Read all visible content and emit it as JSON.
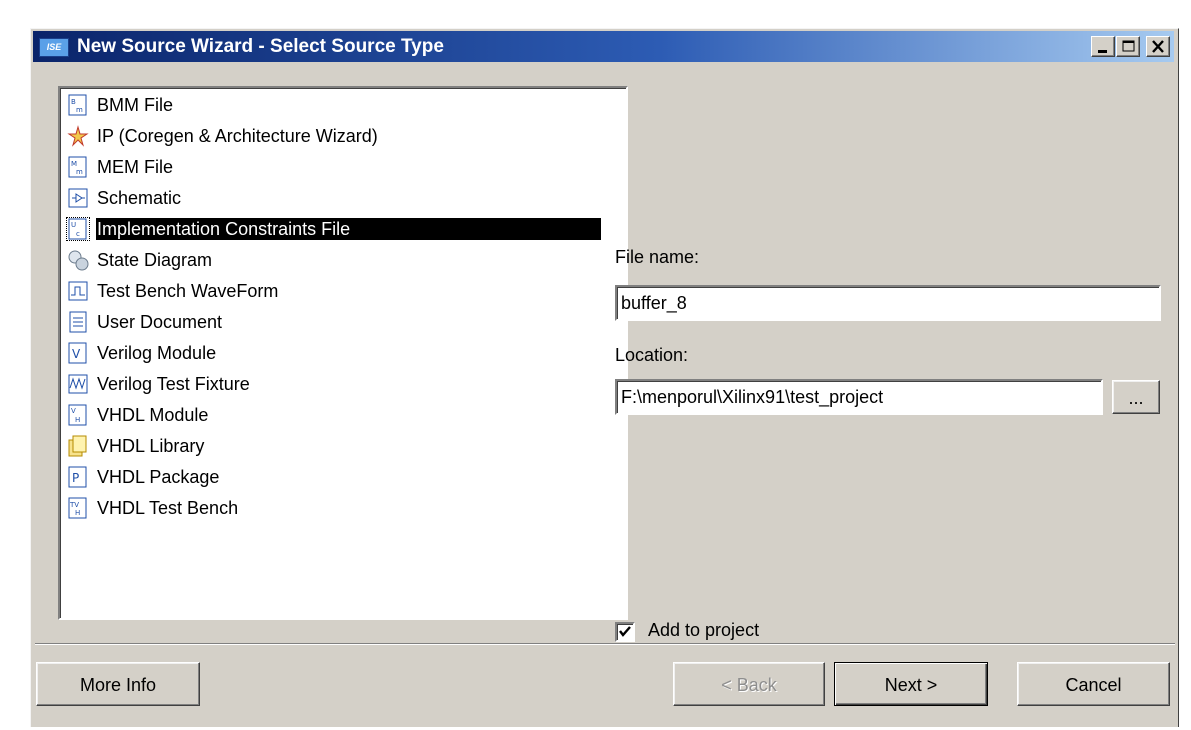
{
  "window": {
    "title": "New Source Wizard - Select Source Type",
    "app_icon_text": "ISE"
  },
  "source_types": [
    {
      "label": "BMM File",
      "icon": "bmm-file-icon"
    },
    {
      "label": "IP (Coregen & Architecture Wizard)",
      "icon": "ip-wizard-icon"
    },
    {
      "label": "MEM File",
      "icon": "mem-file-icon"
    },
    {
      "label": "Schematic",
      "icon": "schematic-icon"
    },
    {
      "label": "Implementation Constraints File",
      "icon": "constraints-file-icon",
      "selected": true
    },
    {
      "label": "State Diagram",
      "icon": "state-diagram-icon"
    },
    {
      "label": "Test Bench WaveForm",
      "icon": "waveform-icon"
    },
    {
      "label": "User Document",
      "icon": "document-icon"
    },
    {
      "label": "Verilog Module",
      "icon": "verilog-module-icon"
    },
    {
      "label": "Verilog Test Fixture",
      "icon": "verilog-fixture-icon"
    },
    {
      "label": "VHDL Module",
      "icon": "vhdl-module-icon"
    },
    {
      "label": "VHDL Library",
      "icon": "vhdl-library-icon"
    },
    {
      "label": "VHDL Package",
      "icon": "vhdl-package-icon"
    },
    {
      "label": "VHDL Test Bench",
      "icon": "vhdl-testbench-icon"
    }
  ],
  "form": {
    "file_name_label": "File name:",
    "file_name_value": "buffer_8",
    "location_label": "Location:",
    "location_value": "F:\\menporul\\Xilinx91\\test_project",
    "browse_label": "...",
    "add_to_project_label": "Add to project",
    "add_to_project_checked": true
  },
  "buttons": {
    "more_info": "More Info",
    "back": "< Back",
    "next": "Next >",
    "cancel": "Cancel"
  },
  "colors": {
    "titlebar_start": "#0a246a",
    "titlebar_end": "#a6caf0",
    "face": "#d4d0c8",
    "selection": "#000000"
  }
}
